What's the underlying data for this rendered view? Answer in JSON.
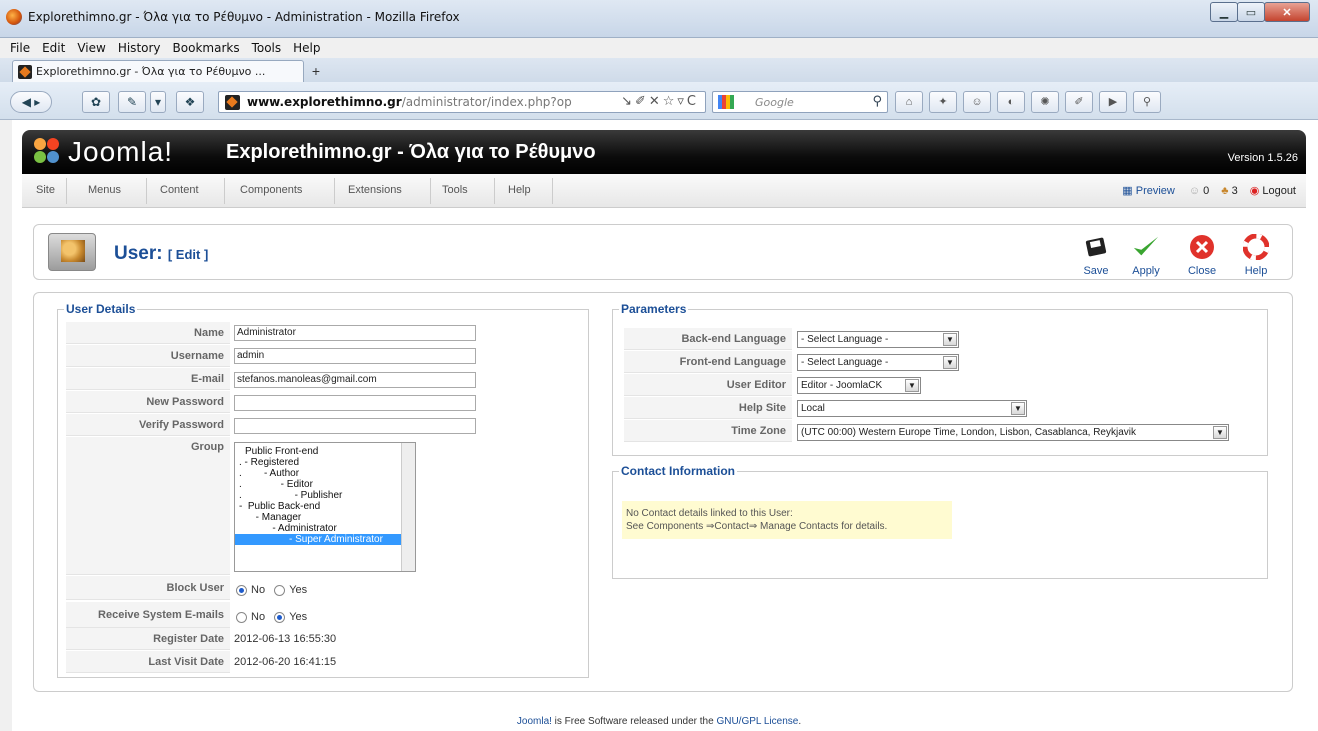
{
  "window": {
    "title": "Explorethimno.gr - Όλα για το Ρέθυμνο - Administration - Mozilla Firefox"
  },
  "browser_menu": [
    "File",
    "Edit",
    "View",
    "History",
    "Bookmarks",
    "Tools",
    "Help"
  ],
  "tab": {
    "label": "Explorethimno.gr - Όλα για το Ρέθυμνο ..."
  },
  "url": {
    "domain": "www.explorethimno.gr",
    "path": "/administrator/index.php?op"
  },
  "search": {
    "placeholder": "Google"
  },
  "joomla": {
    "brand": "Joomla!",
    "site_title": "Explorethimno.gr - Όλα για το Ρέθυμνο",
    "version": "Version 1.5.26",
    "menu": [
      "Site",
      "Menus",
      "Content",
      "Components",
      "Extensions",
      "Tools",
      "Help"
    ],
    "status": {
      "preview": "Preview",
      "messages": "0",
      "users": "3",
      "logout": "Logout"
    }
  },
  "toolbar": {
    "title": "User:",
    "subtitle": "[ Edit ]",
    "save": "Save",
    "apply": "Apply",
    "close": "Close",
    "help": "Help"
  },
  "user_details": {
    "legend": "User Details",
    "name_label": "Name",
    "name_value": "Administrator",
    "username_label": "Username",
    "username_value": "admin",
    "email_label": "E-mail",
    "email_value": "stefanos.manoleas@gmail.com",
    "new_password_label": "New Password",
    "verify_password_label": "Verify Password",
    "group_label": "Group",
    "groups": [
      "Public Front-end",
      ". - Registered",
      ".        - Author",
      ".              - Editor",
      ".                   - Publisher",
      "-  Public Back-end",
      "      - Manager",
      "            - Administrator",
      "                  - Super Administrator"
    ],
    "block_label": "Block User",
    "receive_label": "Receive System E-mails",
    "no": "No",
    "yes": "Yes",
    "register_label": "Register Date",
    "register_value": "2012-06-13 16:55:30",
    "last_visit_label": "Last Visit Date",
    "last_visit_value": "2012-06-20 16:41:15"
  },
  "parameters": {
    "legend": "Parameters",
    "backend_label": "Back-end Language",
    "backend_value": "- Select Language -",
    "frontend_label": "Front-end Language",
    "frontend_value": "- Select Language -",
    "editor_label": "User Editor",
    "editor_value": "Editor - JoomlaCK",
    "helpsite_label": "Help Site",
    "helpsite_value": "Local",
    "timezone_label": "Time Zone",
    "timezone_value": "(UTC 00:00) Western Europe Time, London, Lisbon, Casablanca, Reykjavik"
  },
  "contact": {
    "legend": "Contact Information",
    "line1": "No Contact details linked to this User:",
    "line2": "See Components ⇒Contact⇒ Manage Contacts for details."
  },
  "footer": {
    "joomla": "Joomla!",
    "text": " is Free Software released under the ",
    "license": "GNU/GPL License",
    "end": "."
  }
}
